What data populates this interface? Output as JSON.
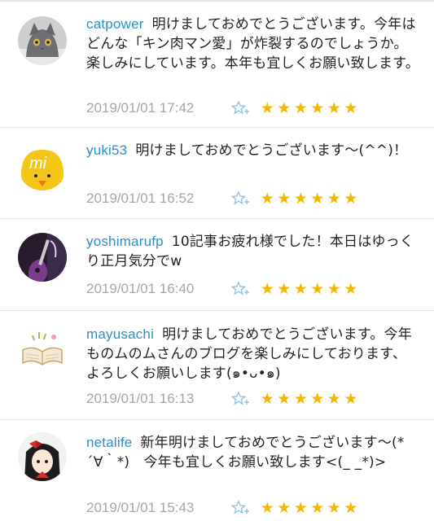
{
  "comments": [
    {
      "username": "catpower",
      "text": "明けましておめでとうございます。今年はどんな「キン肉マン愛」が炸裂するのでしょうか。楽しみにしています。本年も宜しくお願い致します。",
      "timestamp": "2019/01/01 17:42",
      "avatar_icon": "cat-avatar-icon",
      "stars": [
        "★",
        "★",
        "★",
        "★",
        "★",
        "★"
      ]
    },
    {
      "username": "yuki53",
      "text": "明けましておめでとうございます〜(^^)！",
      "timestamp": "2019/01/01 16:52",
      "avatar_icon": "chick-mi-avatar-icon",
      "stars": [
        "★",
        "★",
        "★",
        "★",
        "★",
        "★"
      ]
    },
    {
      "username": "yoshimarufp",
      "text": "10記事お疲れ様でした！本日はゆっくり正月気分でw",
      "timestamp": "2019/01/01 16:40",
      "avatar_icon": "guitar-avatar-icon",
      "stars": [
        "★",
        "★",
        "★",
        "★",
        "★",
        "★"
      ]
    },
    {
      "username": "mayusachi",
      "text": "明けましておめでとうございます。今年ものムのムさんのブログを楽しみにしております、よろしくお願いします(๑•ᴗ•๑)",
      "timestamp": "2019/01/01 16:13",
      "avatar_icon": "open-book-avatar-icon",
      "stars": [
        "★",
        "★",
        "★",
        "★",
        "★",
        "★"
      ]
    },
    {
      "username": "netalife",
      "text": "新年明けましておめでとうございます〜(*´∀｀*)　今年も宜しくお願い致します<(_ _*)>",
      "timestamp": "2019/01/01 15:43",
      "avatar_icon": "anime-girl-avatar-icon",
      "stars": [
        "★",
        "★",
        "★",
        "★",
        "★",
        "★"
      ]
    }
  ],
  "colors": {
    "username": "#2d8fc4",
    "timestamp": "#a7a7a7",
    "star": "#f5b800",
    "add_star": "#8ec3e8",
    "body_text": "#222222"
  }
}
